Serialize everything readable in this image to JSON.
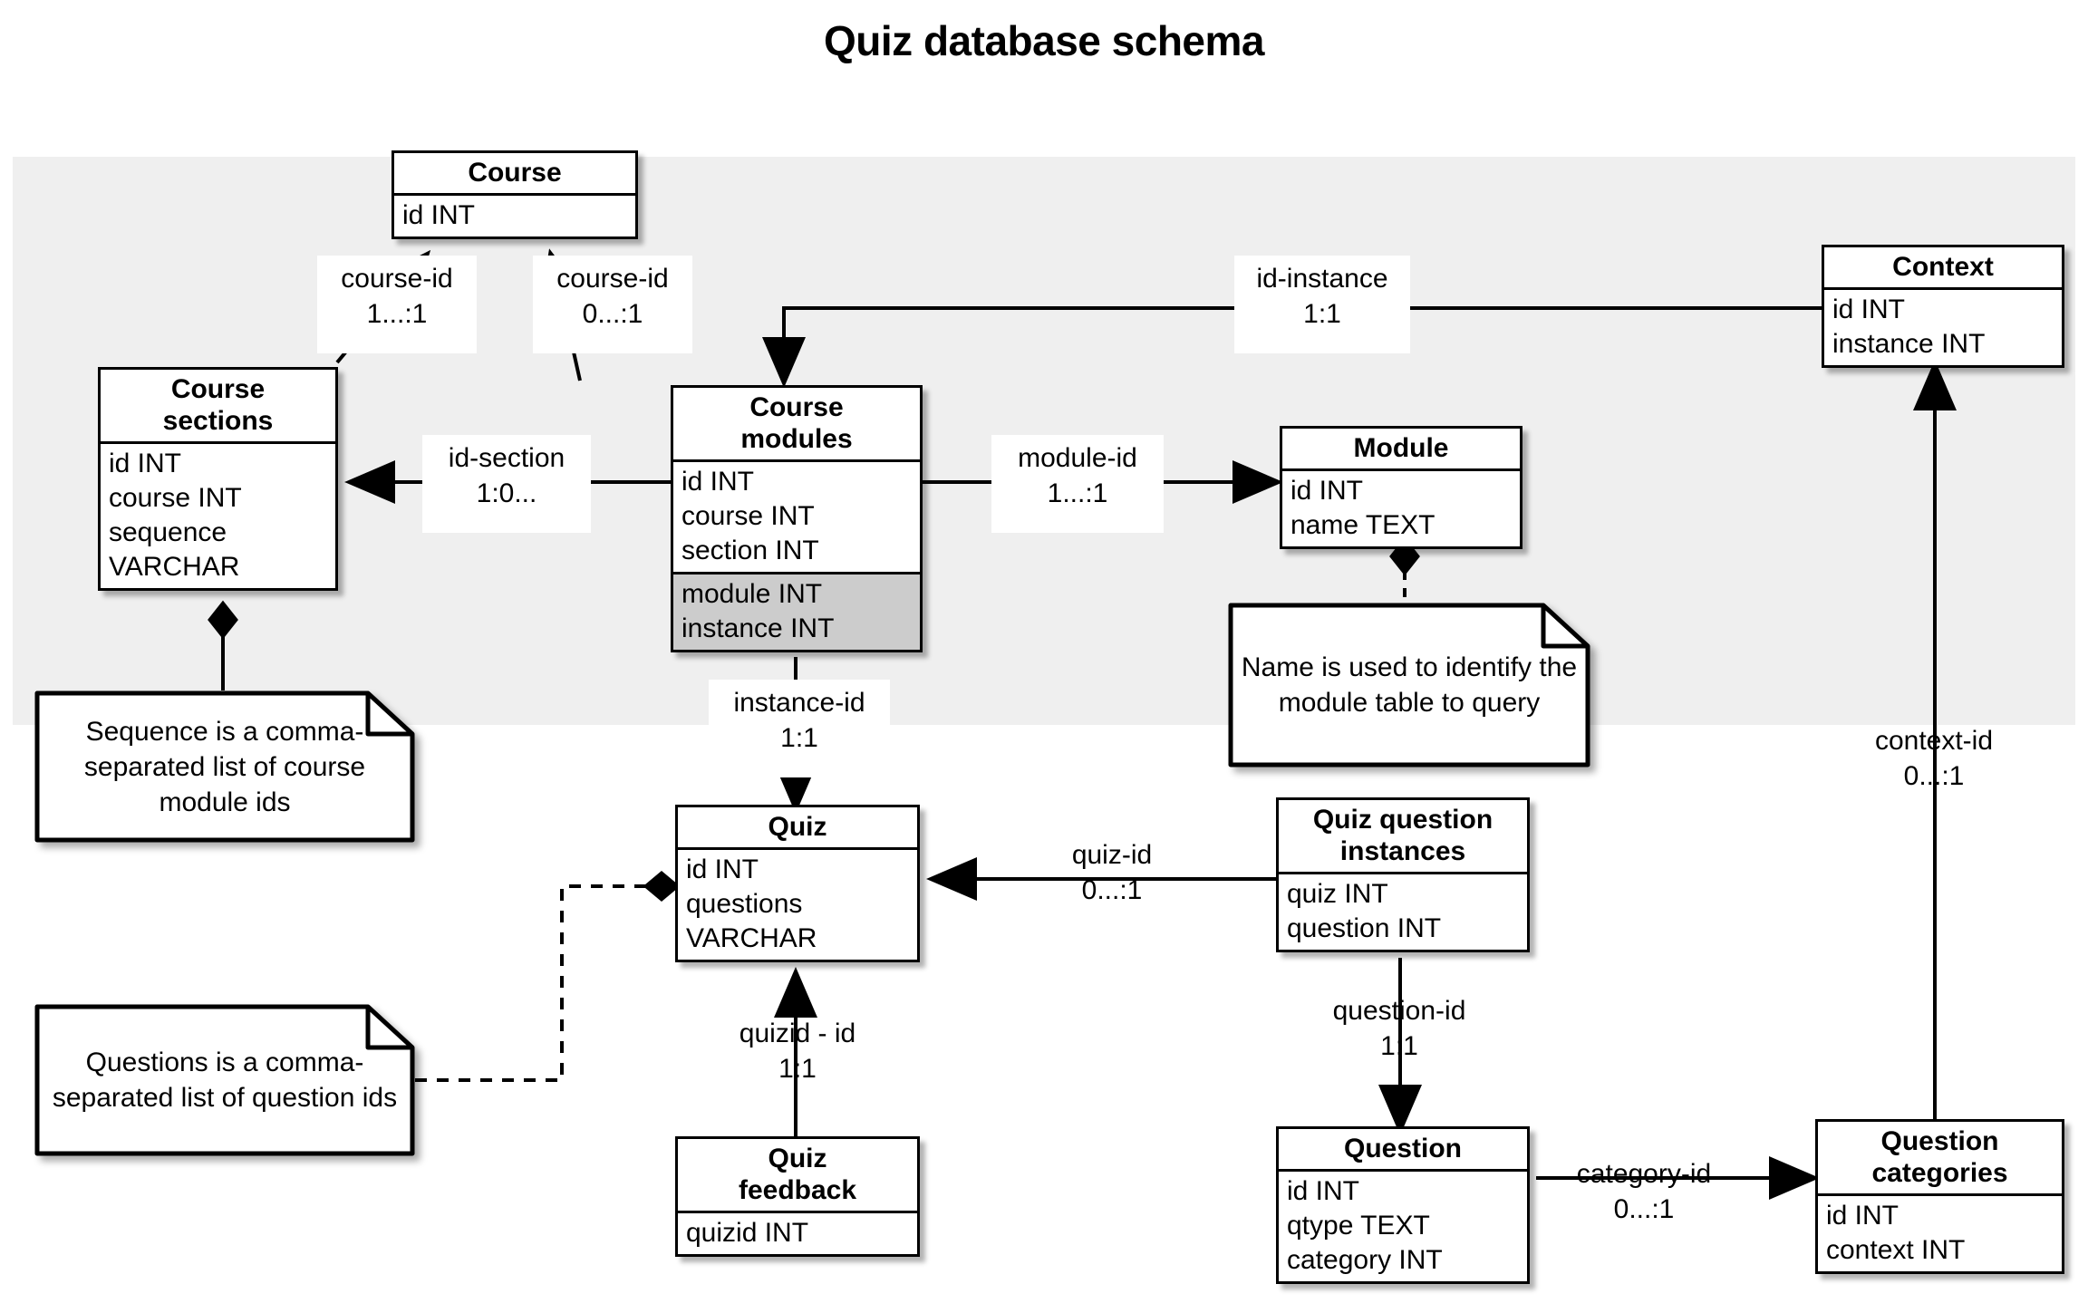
{
  "title": "Quiz database schema",
  "colors": {
    "region_background": "#efefef",
    "highlight_row": "#cccccc",
    "stroke": "#000000",
    "box_fill": "#ffffff"
  },
  "tables": {
    "course": {
      "name": "Course",
      "attributes": [
        "id INT"
      ]
    },
    "course_sections": {
      "name": "Course\nsections",
      "attributes": [
        "id INT",
        "course INT",
        "sequence",
        "VARCHAR"
      ]
    },
    "course_modules": {
      "name": "Course\nmodules",
      "attributes": [
        "id INT",
        "course INT",
        "section INT"
      ],
      "highlighted_attributes": [
        "module INT",
        "instance INT"
      ]
    },
    "module": {
      "name": "Module",
      "attributes": [
        "id INT",
        "name TEXT"
      ]
    },
    "context": {
      "name": "Context",
      "attributes": [
        "id INT",
        "instance INT"
      ]
    },
    "quiz": {
      "name": "Quiz",
      "attributes": [
        "id INT",
        "questions",
        "VARCHAR"
      ]
    },
    "quiz_feedback": {
      "name": "Quiz\nfeedback",
      "attributes": [
        "quizid INT"
      ]
    },
    "quiz_question_instances": {
      "name": "Quiz question\ninstances",
      "attributes": [
        "quiz INT",
        "question INT"
      ]
    },
    "question": {
      "name": "Question",
      "attributes": [
        "id INT",
        "qtype TEXT",
        "category INT"
      ]
    },
    "question_categories": {
      "name": "Question\ncategories",
      "attributes": [
        "id INT",
        "context INT"
      ]
    }
  },
  "edge_labels": {
    "course_id_1_1": "course-id\n1...:1",
    "course_id_0_1": "course-id\n0...:1",
    "id_instance": "id-instance\n1:1",
    "id_section": "id-section\n1:0...",
    "module_id": "module-id\n1...:1",
    "instance_id": "instance-id\n1:1",
    "context_id": "context-id\n0...:1",
    "quiz_id": "quiz-id\n0...:1",
    "quizid_id": "quizid - id\n1:1",
    "question_id": "question-id\n1:1",
    "category_id": "category-id\n0...:1"
  },
  "notes": {
    "sequence_note": "Sequence is a comma-separated list of course module ids",
    "questions_note": "Questions is a comma-separated list of question ids",
    "module_name_note": "Name is used to identify the module table to query"
  }
}
